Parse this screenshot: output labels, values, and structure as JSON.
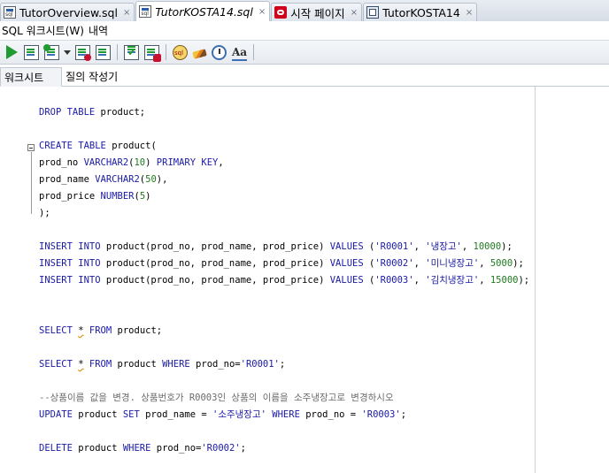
{
  "doc_tabs": [
    {
      "label": "TutorOverview.sql",
      "icon": "sql-file-icon",
      "active": false
    },
    {
      "label": "TutorKOSTA14.sql",
      "icon": "sql-file-icon",
      "active": true
    },
    {
      "label": "시작 페이지",
      "icon": "oracle-start-icon",
      "active": false
    },
    {
      "label": "TutorKOSTA14",
      "icon": "worksheet-connection-icon",
      "active": false
    }
  ],
  "close_glyph": "×",
  "menu": {
    "worksheet": "SQL 워크시트(W)",
    "history": "내역"
  },
  "toolbar_icons": [
    "run-statement-icon",
    "run-script-icon",
    "autotrace-icon",
    "explain-plan-icon",
    "sql-tuning-icon",
    "commit-icon",
    "rollback-icon",
    "unshared-sql-icon",
    "clear-icon",
    "sql-history-icon",
    "format-case-icon"
  ],
  "subtabs": {
    "worksheet": "워크시트",
    "query_builder": "질의 작성기"
  },
  "code_lines": [
    [
      {
        "t": "DROP TABLE ",
        "c": "kw"
      },
      {
        "t": "product;",
        "c": ""
      }
    ],
    [],
    [
      {
        "t": "CREATE TABLE ",
        "c": "kw"
      },
      {
        "t": "product(",
        "c": ""
      }
    ],
    [
      {
        "t": "prod_no ",
        "c": ""
      },
      {
        "t": "VARCHAR2",
        "c": "kw"
      },
      {
        "t": "(",
        "c": ""
      },
      {
        "t": "10",
        "c": "num"
      },
      {
        "t": ") ",
        "c": ""
      },
      {
        "t": "PRIMARY KEY",
        "c": "kw"
      },
      {
        "t": ",",
        "c": ""
      }
    ],
    [
      {
        "t": "prod_name ",
        "c": ""
      },
      {
        "t": "VARCHAR2",
        "c": "kw"
      },
      {
        "t": "(",
        "c": ""
      },
      {
        "t": "50",
        "c": "num"
      },
      {
        "t": "),",
        "c": ""
      }
    ],
    [
      {
        "t": "prod_price ",
        "c": ""
      },
      {
        "t": "NUMBER",
        "c": "kw"
      },
      {
        "t": "(",
        "c": ""
      },
      {
        "t": "5",
        "c": "num"
      },
      {
        "t": ")",
        "c": ""
      }
    ],
    [
      {
        "t": ");",
        "c": ""
      }
    ],
    [],
    [
      {
        "t": "INSERT INTO ",
        "c": "kw"
      },
      {
        "t": "product(prod_no, prod_name, prod_price) ",
        "c": ""
      },
      {
        "t": "VALUES ",
        "c": "kw"
      },
      {
        "t": "(",
        "c": ""
      },
      {
        "t": "'R0001'",
        "c": "str"
      },
      {
        "t": ", ",
        "c": ""
      },
      {
        "t": "'냉장고'",
        "c": "str"
      },
      {
        "t": ", ",
        "c": ""
      },
      {
        "t": "10000",
        "c": "num"
      },
      {
        "t": ");",
        "c": ""
      }
    ],
    [
      {
        "t": "INSERT INTO ",
        "c": "kw"
      },
      {
        "t": "product(prod_no, prod_name, prod_price) ",
        "c": ""
      },
      {
        "t": "VALUES ",
        "c": "kw"
      },
      {
        "t": "(",
        "c": ""
      },
      {
        "t": "'R0002'",
        "c": "str"
      },
      {
        "t": ", ",
        "c": ""
      },
      {
        "t": "'미니냉장고'",
        "c": "str"
      },
      {
        "t": ", ",
        "c": ""
      },
      {
        "t": "5000",
        "c": "num"
      },
      {
        "t": ");",
        "c": ""
      }
    ],
    [
      {
        "t": "INSERT INTO ",
        "c": "kw"
      },
      {
        "t": "product(prod_no, prod_name, prod_price) ",
        "c": ""
      },
      {
        "t": "VALUES ",
        "c": "kw"
      },
      {
        "t": "(",
        "c": ""
      },
      {
        "t": "'R0003'",
        "c": "str"
      },
      {
        "t": ", ",
        "c": ""
      },
      {
        "t": "'김치냉장고'",
        "c": "str"
      },
      {
        "t": ", ",
        "c": ""
      },
      {
        "t": "15000",
        "c": "num"
      },
      {
        "t": ");",
        "c": ""
      }
    ],
    [],
    [],
    [
      {
        "t": "SELECT ",
        "c": "kw"
      },
      {
        "t": "*",
        "c": "star"
      },
      {
        "t": " FROM ",
        "c": "kw"
      },
      {
        "t": "product;",
        "c": ""
      }
    ],
    [],
    [
      {
        "t": "SELECT ",
        "c": "kw"
      },
      {
        "t": "*",
        "c": "star"
      },
      {
        "t": " FROM ",
        "c": "kw"
      },
      {
        "t": "product ",
        "c": ""
      },
      {
        "t": "WHERE ",
        "c": "kw"
      },
      {
        "t": "prod_no=",
        "c": ""
      },
      {
        "t": "'R0001'",
        "c": "str"
      },
      {
        "t": ";",
        "c": ""
      }
    ],
    [],
    [
      {
        "t": "--상품이름 값을 변경. 상품번호가 R0003인 상품의 이름을 소주냉장고로 변경하시오",
        "c": "cmt"
      }
    ],
    [
      {
        "t": "UPDATE ",
        "c": "kw"
      },
      {
        "t": "product ",
        "c": ""
      },
      {
        "t": "SET ",
        "c": "kw"
      },
      {
        "t": "prod_name = ",
        "c": ""
      },
      {
        "t": "'소주냉장고'",
        "c": "str"
      },
      {
        "t": " ",
        "c": ""
      },
      {
        "t": "WHERE ",
        "c": "kw"
      },
      {
        "t": "prod_no = ",
        "c": ""
      },
      {
        "t": "'R0003'",
        "c": "str"
      },
      {
        "t": ";",
        "c": ""
      }
    ],
    [],
    [
      {
        "t": "DELETE ",
        "c": "kw"
      },
      {
        "t": "product ",
        "c": ""
      },
      {
        "t": "WHERE ",
        "c": "kw"
      },
      {
        "t": "prod_no=",
        "c": ""
      },
      {
        "t": "'R0002'",
        "c": "str"
      },
      {
        "t": ";",
        "c": ""
      }
    ]
  ]
}
